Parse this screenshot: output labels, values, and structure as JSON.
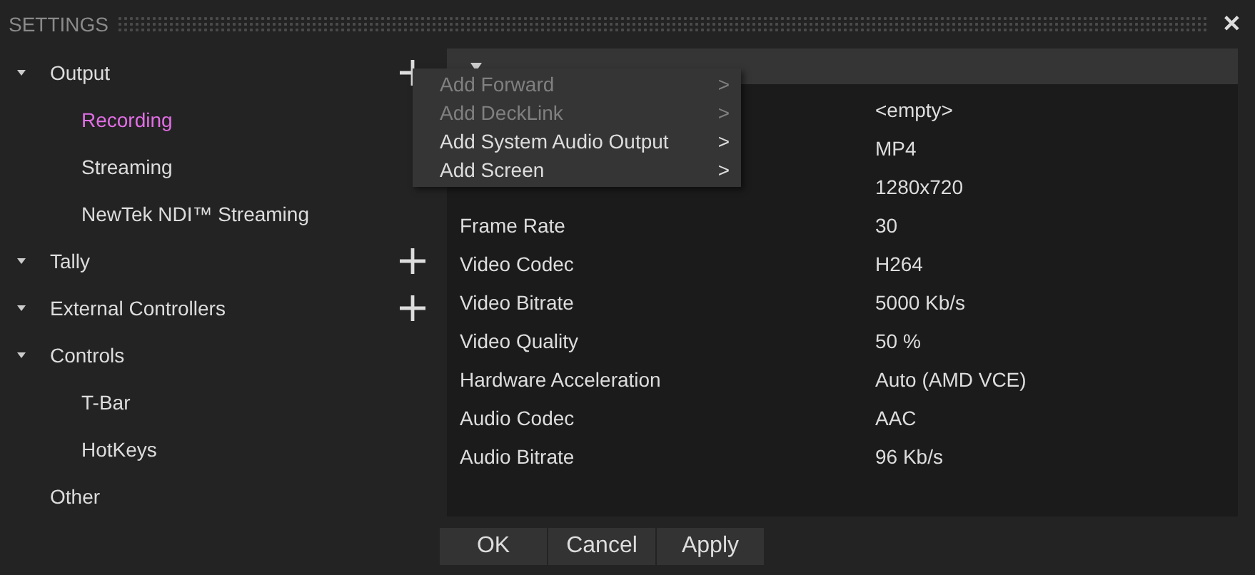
{
  "window": {
    "title": "SETTINGS",
    "close": "✕"
  },
  "tree": [
    {
      "label": "Output",
      "expanded": true,
      "selected": false,
      "add": true,
      "children": [
        {
          "label": "Recording",
          "selected": true
        },
        {
          "label": "Streaming",
          "selected": false
        },
        {
          "label": "NewTek NDI™ Streaming",
          "selected": false
        }
      ]
    },
    {
      "label": "Tally",
      "expanded": true,
      "selected": false,
      "add": true
    },
    {
      "label": "External Controllers",
      "expanded": true,
      "selected": false,
      "add": true
    },
    {
      "label": "Controls",
      "expanded": true,
      "selected": false,
      "children": [
        {
          "label": "T-Bar",
          "selected": false
        },
        {
          "label": "HotKeys",
          "selected": false
        }
      ]
    },
    {
      "label": "Other",
      "selected": false
    }
  ],
  "panel": {
    "rows": [
      {
        "value": "<empty>"
      },
      {
        "value": "MP4"
      },
      {
        "value": "1280x720"
      },
      {
        "label": "Frame Rate",
        "value": "30"
      },
      {
        "label": "Video Codec",
        "value": "H264"
      },
      {
        "label": "Video Bitrate",
        "value": "5000 Kb/s"
      },
      {
        "label": "Video Quality",
        "value": "50 %"
      },
      {
        "label": "Hardware Acceleration",
        "value": "Auto (AMD VCE)"
      },
      {
        "label": "Audio Codec",
        "value": "AAC"
      },
      {
        "label": "Audio Bitrate",
        "value": "96 Kb/s"
      }
    ]
  },
  "menu": [
    {
      "label": "Add Forward",
      "arrow": ">",
      "disabled": true
    },
    {
      "label": "Add DeckLink",
      "arrow": ">",
      "disabled": true
    },
    {
      "label": "Add System Audio Output",
      "arrow": ">",
      "disabled": false
    },
    {
      "label": "Add Screen",
      "arrow": ">",
      "disabled": false
    }
  ],
  "buttons": [
    "OK",
    "Cancel",
    "Apply"
  ]
}
